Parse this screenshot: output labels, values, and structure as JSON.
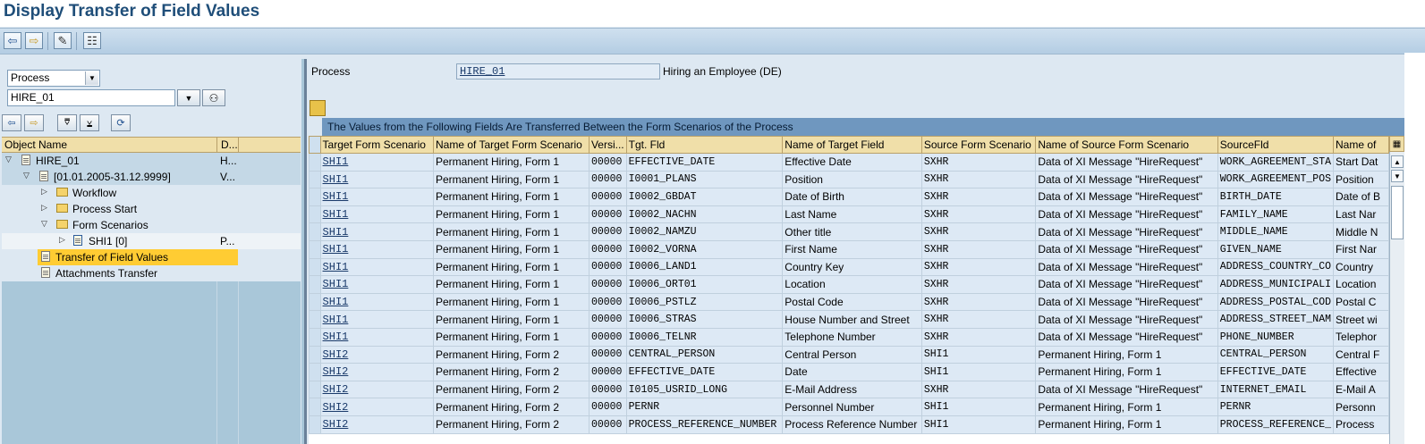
{
  "title": "Display Transfer of Field Values",
  "toolbar": {
    "back_icon": "⇦",
    "forward_icon": "⇨",
    "edit_icon": "✎",
    "hierarchy_icon": "☷"
  },
  "left": {
    "object_type": "Process",
    "object_value": "HIRE_01",
    "tree_columns": [
      "Object Name",
      "D..."
    ],
    "tree": [
      {
        "label": "HIRE_01",
        "desc": "H..."
      },
      {
        "label": "[01.01.2005-31.12.9999]",
        "desc": "V..."
      },
      {
        "label": "Workflow",
        "desc": ""
      },
      {
        "label": "Process Start",
        "desc": ""
      },
      {
        "label": "Form Scenarios",
        "desc": ""
      },
      {
        "label": "SHI1 [0]",
        "desc": "P..."
      },
      {
        "label": "Transfer of Field Values",
        "desc": ""
      },
      {
        "label": "Attachments Transfer",
        "desc": ""
      }
    ]
  },
  "header": {
    "process_label": "Process",
    "process_value": "HIRE_01",
    "process_desc": "Hiring an Employee (DE)"
  },
  "grid": {
    "title": "The Values from the Following Fields Are Transferred Between the Form Scenarios of the Process",
    "columns": [
      "Target Form Scenario",
      "Name of Target Form Scenario",
      "Versi...",
      "Tgt. Fld",
      "Name of Target Field",
      "Source Form Scenario",
      "Name of Source Form Scenario",
      "SourceFld",
      "Name of"
    ],
    "rows": [
      [
        "SHI1",
        "Permanent Hiring, Form 1",
        "00000",
        "EFFECTIVE_DATE",
        "Effective Date",
        "SXHR",
        "Data of XI Message \"HireRequest\"",
        "WORK_AGREEMENT_STA",
        "Start Dat"
      ],
      [
        "SHI1",
        "Permanent Hiring, Form 1",
        "00000",
        "I0001_PLANS",
        "Position",
        "SXHR",
        "Data of XI Message \"HireRequest\"",
        "WORK_AGREEMENT_POS",
        "Position"
      ],
      [
        "SHI1",
        "Permanent Hiring, Form 1",
        "00000",
        "I0002_GBDAT",
        "Date of Birth",
        "SXHR",
        "Data of XI Message \"HireRequest\"",
        "BIRTH_DATE",
        "Date of B"
      ],
      [
        "SHI1",
        "Permanent Hiring, Form 1",
        "00000",
        "I0002_NACHN",
        "Last Name",
        "SXHR",
        "Data of XI Message \"HireRequest\"",
        "FAMILY_NAME",
        "Last Nar"
      ],
      [
        "SHI1",
        "Permanent Hiring, Form 1",
        "00000",
        "I0002_NAMZU",
        "Other title",
        "SXHR",
        "Data of XI Message \"HireRequest\"",
        "MIDDLE_NAME",
        "Middle N"
      ],
      [
        "SHI1",
        "Permanent Hiring, Form 1",
        "00000",
        "I0002_VORNA",
        "First Name",
        "SXHR",
        "Data of XI Message \"HireRequest\"",
        "GIVEN_NAME",
        "First Nar"
      ],
      [
        "SHI1",
        "Permanent Hiring, Form 1",
        "00000",
        "I0006_LAND1",
        "Country Key",
        "SXHR",
        "Data of XI Message \"HireRequest\"",
        "ADDRESS_COUNTRY_CO",
        "Country"
      ],
      [
        "SHI1",
        "Permanent Hiring, Form 1",
        "00000",
        "I0006_ORT01",
        "Location",
        "SXHR",
        "Data of XI Message \"HireRequest\"",
        "ADDRESS_MUNICIPALI",
        "Location"
      ],
      [
        "SHI1",
        "Permanent Hiring, Form 1",
        "00000",
        "I0006_PSTLZ",
        "Postal Code",
        "SXHR",
        "Data of XI Message \"HireRequest\"",
        "ADDRESS_POSTAL_COD",
        "Postal C"
      ],
      [
        "SHI1",
        "Permanent Hiring, Form 1",
        "00000",
        "I0006_STRAS",
        "House Number and Street",
        "SXHR",
        "Data of XI Message \"HireRequest\"",
        "ADDRESS_STREET_NAM",
        "Street wi"
      ],
      [
        "SHI1",
        "Permanent Hiring, Form 1",
        "00000",
        "I0006_TELNR",
        "Telephone Number",
        "SXHR",
        "Data of XI Message \"HireRequest\"",
        "PHONE_NUMBER",
        "Telephor"
      ],
      [
        "SHI2",
        "Permanent Hiring, Form 2",
        "00000",
        "CENTRAL_PERSON",
        "Central Person",
        "SHI1",
        "Permanent Hiring, Form 1",
        "CENTRAL_PERSON",
        "Central F"
      ],
      [
        "SHI2",
        "Permanent Hiring, Form 2",
        "00000",
        "EFFECTIVE_DATE",
        "Date",
        "SHI1",
        "Permanent Hiring, Form 1",
        "EFFECTIVE_DATE",
        "Effective"
      ],
      [
        "SHI2",
        "Permanent Hiring, Form 2",
        "00000",
        "I0105_USRID_LONG",
        "E-Mail Address",
        "SXHR",
        "Data of XI Message \"HireRequest\"",
        "INTERNET_EMAIL",
        "E-Mail A"
      ],
      [
        "SHI2",
        "Permanent Hiring, Form 2",
        "00000",
        "PERNR",
        "Personnel Number",
        "SHI1",
        "Permanent Hiring, Form 1",
        "PERNR",
        "Personn"
      ],
      [
        "SHI2",
        "Permanent Hiring, Form 2",
        "00000",
        "PROCESS_REFERENCE_NUMBER",
        "Process Reference Number",
        "SHI1",
        "Permanent Hiring, Form 1",
        "PROCESS_REFERENCE_",
        "Process"
      ]
    ]
  },
  "colors": {
    "title": "#1f4e79",
    "header_bg": "#f0dfa9",
    "selected": "#ffcc33",
    "grid_title": "#6f97bf"
  }
}
